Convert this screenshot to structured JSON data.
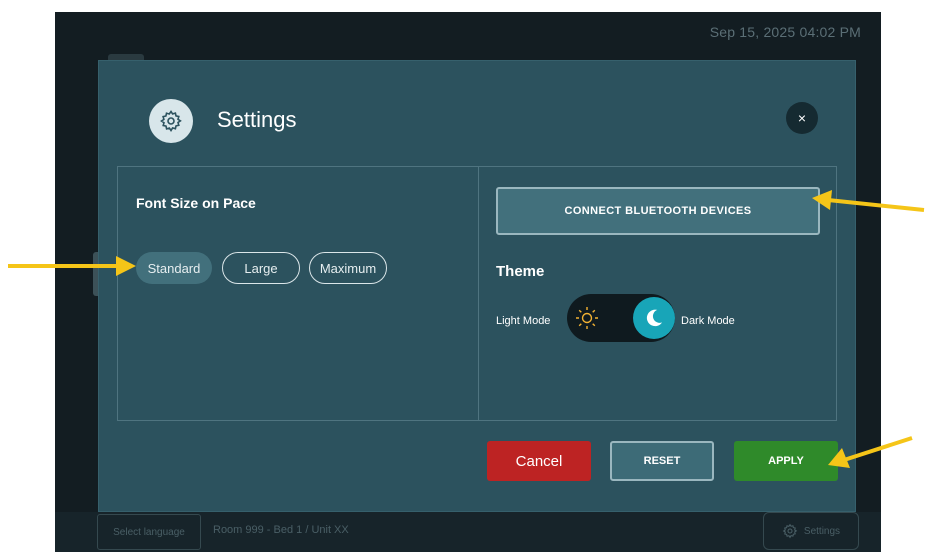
{
  "status_bar": {
    "datetime": "Sep 15, 2025  04:02 PM"
  },
  "modal": {
    "title": "Settings",
    "close_label": "×",
    "font_size": {
      "title": "Font Size on Pace",
      "options": [
        "Standard",
        "Large",
        "Maximum"
      ],
      "selected": "Standard"
    },
    "bluetooth_button": "CONNECT BLUETOOTH DEVICES",
    "theme": {
      "title": "Theme",
      "light_label": "Light Mode",
      "dark_label": "Dark Mode",
      "selected": "Dark Mode"
    },
    "buttons": {
      "cancel": "Cancel",
      "reset": "RESET",
      "apply": "APPLY"
    }
  },
  "bottom_bar": {
    "language_button": "Select language",
    "room_info": "Room 999 -  Bed  1 / Unit XX",
    "settings_button": "Settings"
  },
  "colors": {
    "modal_bg": "#2c525e",
    "accent_teal": "#18a5b8",
    "cancel_red": "#bd2323",
    "apply_green": "#2f8a2a",
    "annotation_arrow": "#f5c518"
  },
  "icons": [
    "gear-icon",
    "close-icon",
    "sun-icon",
    "moon-icon",
    "arrow-annotation"
  ]
}
